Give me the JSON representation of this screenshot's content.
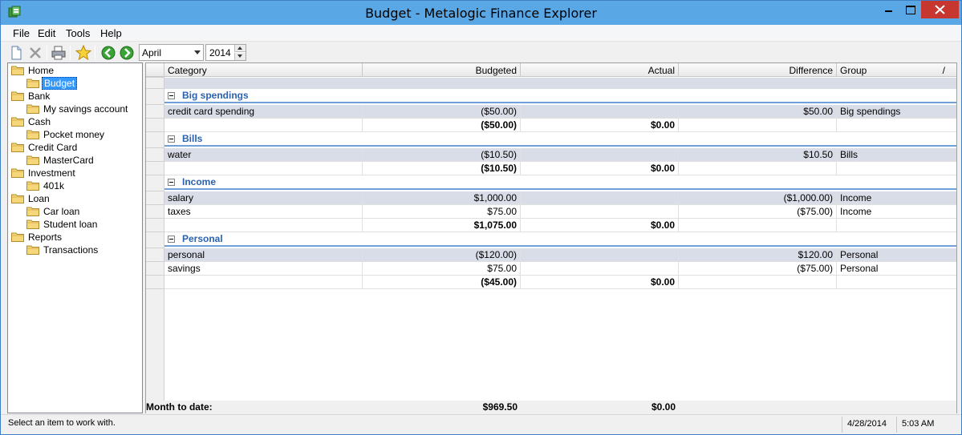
{
  "window": {
    "title": "Budget - Metalogic Finance Explorer"
  },
  "menubar": {
    "items": [
      "File",
      "Edit",
      "Tools",
      "Help"
    ]
  },
  "toolbar": {
    "icons": [
      "new-icon",
      "delete-icon",
      "print-icon",
      "favorite-icon",
      "back-icon",
      "forward-icon"
    ],
    "month": "April",
    "year": "2014"
  },
  "tree": {
    "items": [
      {
        "label": "Home",
        "level": 0
      },
      {
        "label": "Budget",
        "level": 1,
        "selected": true
      },
      {
        "label": "Bank",
        "level": 0
      },
      {
        "label": "My savings account",
        "level": 1
      },
      {
        "label": "Cash",
        "level": 0
      },
      {
        "label": "Pocket money",
        "level": 1
      },
      {
        "label": "Credit Card",
        "level": 0
      },
      {
        "label": "MasterCard",
        "level": 1
      },
      {
        "label": "Investment",
        "level": 0
      },
      {
        "label": "401k",
        "level": 1
      },
      {
        "label": "Loan",
        "level": 0
      },
      {
        "label": "Car loan",
        "level": 1
      },
      {
        "label": "Student loan",
        "level": 1
      },
      {
        "label": "Reports",
        "level": 0
      },
      {
        "label": "Transactions",
        "level": 1
      }
    ]
  },
  "grid": {
    "columns": {
      "category": "Category",
      "budgeted": "Budgeted",
      "actual": "Actual",
      "difference": "Difference",
      "group": "Group",
      "sort_glyph": "/"
    },
    "groups": [
      {
        "title": "Big spendings",
        "rows": [
          {
            "category": "credit card spending",
            "budgeted": "($50.00)",
            "actual": "",
            "difference": "$50.00",
            "group": "Big spendings"
          }
        ],
        "subtotal": {
          "budgeted": "($50.00)",
          "actual": "$0.00"
        }
      },
      {
        "title": "Bills",
        "rows": [
          {
            "category": "water",
            "budgeted": "($10.50)",
            "actual": "",
            "difference": "$10.50",
            "group": "Bills"
          }
        ],
        "subtotal": {
          "budgeted": "($10.50)",
          "actual": "$0.00"
        }
      },
      {
        "title": "Income",
        "rows": [
          {
            "category": "salary",
            "budgeted": "$1,000.00",
            "actual": "",
            "difference": "($1,000.00)",
            "group": "Income"
          },
          {
            "category": "taxes",
            "budgeted": "$75.00",
            "actual": "",
            "difference": "($75.00)",
            "group": "Income"
          }
        ],
        "subtotal": {
          "budgeted": "$1,075.00",
          "actual": "$0.00"
        }
      },
      {
        "title": "Personal",
        "rows": [
          {
            "category": "personal",
            "budgeted": "($120.00)",
            "actual": "",
            "difference": "$120.00",
            "group": "Personal"
          },
          {
            "category": "savings",
            "budgeted": "$75.00",
            "actual": "",
            "difference": "($75.00)",
            "group": "Personal"
          }
        ],
        "subtotal": {
          "budgeted": "($45.00)",
          "actual": "$0.00"
        }
      }
    ],
    "totals": {
      "label": "Month to date:",
      "budgeted": "$969.50",
      "actual": "$0.00"
    }
  },
  "statusbar": {
    "message": "Select an item to work with.",
    "date": "4/28/2014",
    "time": "5:03 AM"
  }
}
